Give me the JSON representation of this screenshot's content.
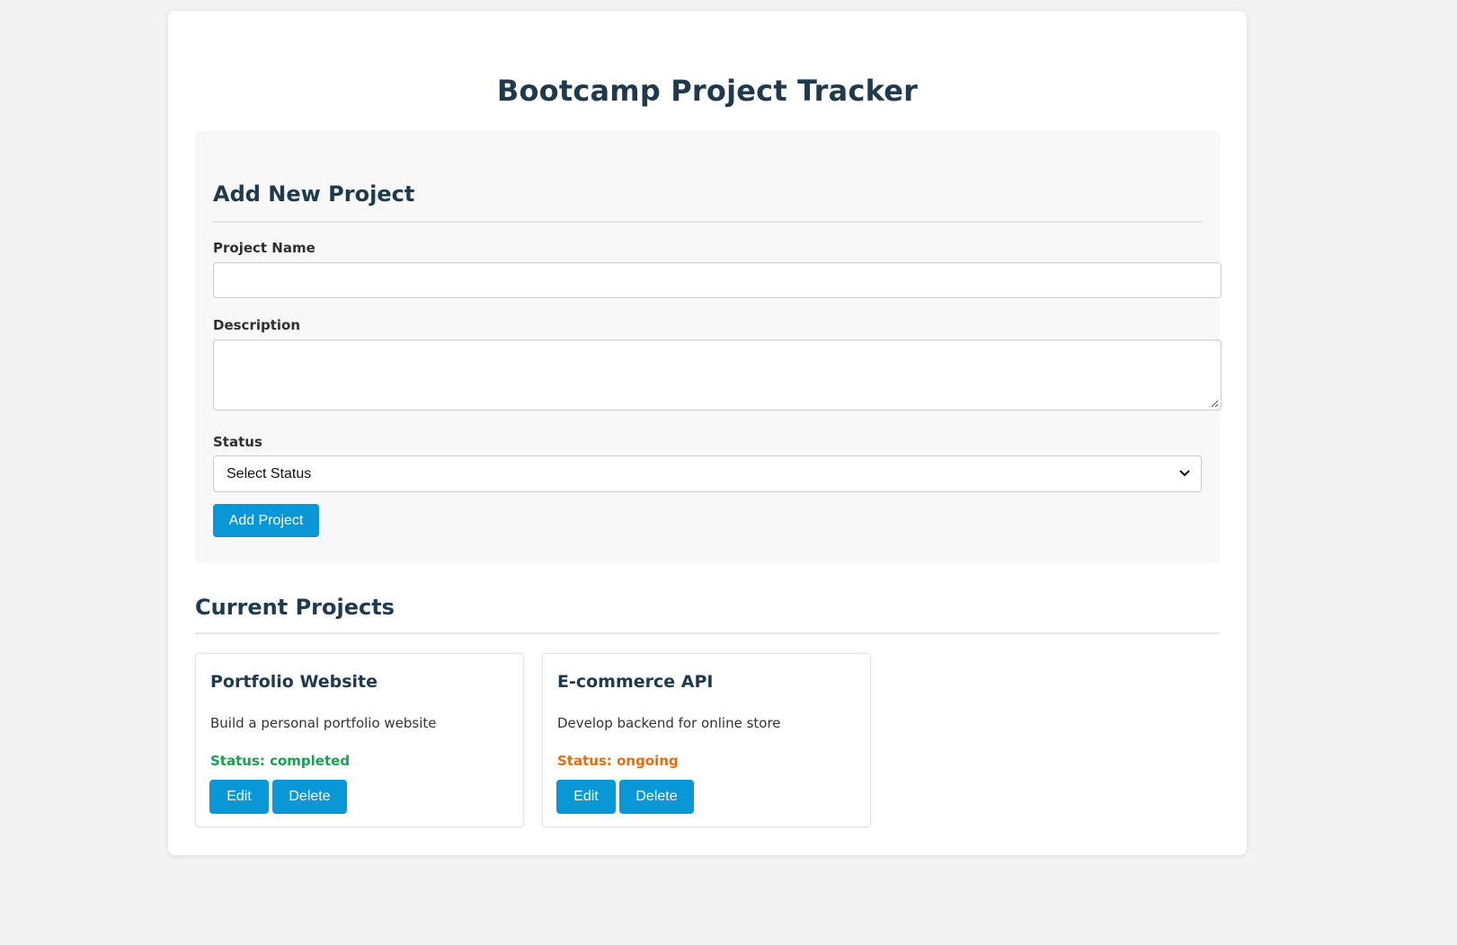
{
  "header": {
    "title": "Bootcamp Project Tracker"
  },
  "form": {
    "heading": "Add New Project",
    "name_label": "Project Name",
    "name_value": "",
    "description_label": "Description",
    "description_value": "",
    "status_label": "Status",
    "status_selected": "Select Status",
    "submit_label": "Add Project"
  },
  "projects_section": {
    "heading": "Current Projects",
    "items": [
      {
        "title": "Portfolio Website",
        "description": "Build a personal portfolio website",
        "status_text": "Status: completed",
        "status_color": "#16a34a",
        "edit_label": "Edit",
        "delete_label": "Delete"
      },
      {
        "title": "E-commerce API",
        "description": "Develop backend for online store",
        "status_text": "Status: ongoing",
        "status_color": "#ea6b0c",
        "edit_label": "Edit",
        "delete_label": "Delete"
      }
    ]
  },
  "colors": {
    "accent": "#0a97d7",
    "heading": "#1e3a4c",
    "background": "#f3f3f3"
  },
  "icons": {
    "select_arrow": "chevron-down-icon",
    "textarea_resize": "resize-handle-icon"
  }
}
